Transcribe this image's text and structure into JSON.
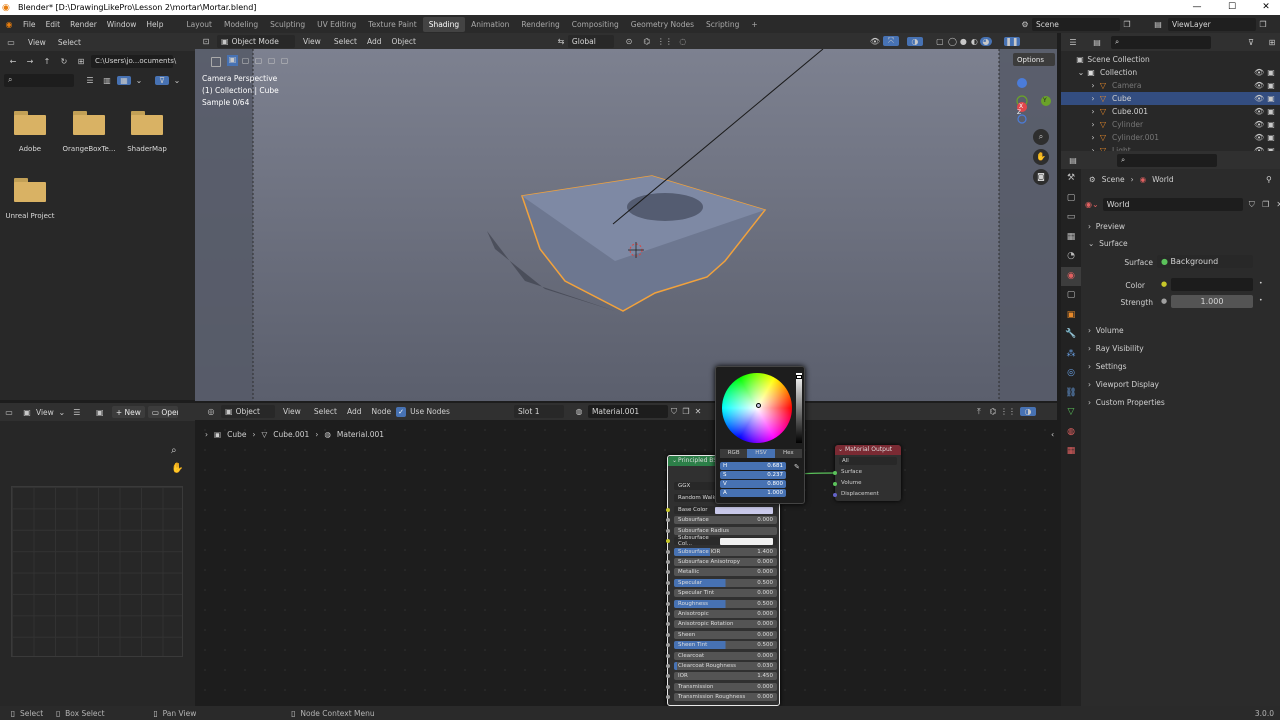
{
  "titlebar": {
    "title": "Blender* [D:\\DrawingLikePro\\Lesson 2\\mortar\\Mortar.blend]",
    "min": "—",
    "max": "☐",
    "close": "✕"
  },
  "menu": {
    "items": [
      "File",
      "Edit",
      "Render",
      "Window",
      "Help"
    ],
    "workspaces": [
      "Layout",
      "Modeling",
      "Sculpting",
      "UV Editing",
      "Texture Paint",
      "Shading",
      "Animation",
      "Rendering",
      "Compositing",
      "Geometry Nodes",
      "Scripting"
    ],
    "active_workspace": "Shading",
    "add": "+",
    "scene": "Scene",
    "view_layer": "ViewLayer"
  },
  "filebrowser": {
    "view": "View",
    "select": "Select",
    "path": "C:\\Users\\jo...ocuments\\",
    "folders": [
      "Adobe",
      "OrangeBoxTe...",
      "ShaderMap",
      "Unreal Project"
    ]
  },
  "viewport": {
    "mode": "Object Mode",
    "menus": [
      "View",
      "Select",
      "Add",
      "Object"
    ],
    "orientation": "Global",
    "options": "Options",
    "overlay_lines": [
      "Camera Perspective",
      "(1) Collection | Cube",
      "Sample 0/64"
    ],
    "gizmo": {
      "x": "X",
      "y": "Y",
      "z": "Z"
    }
  },
  "node_editor": {
    "editor_type": "Object",
    "menus": [
      "View",
      "Select",
      "Add",
      "Node"
    ],
    "use_nodes": "Use Nodes",
    "slot": "Slot 1",
    "material": "Material.001",
    "breadcrumb": [
      "Cube",
      "Cube.001",
      "Material.001"
    ],
    "image_editor": {
      "view": "View",
      "new": "New",
      "open": "Open"
    },
    "principled": {
      "title": "Principled BSDF",
      "dist": "GGX",
      "sss": "Random Walk",
      "rows": [
        {
          "label": "Base Color",
          "value": "",
          "fill": 0,
          "color": "#c9c9ea"
        },
        {
          "label": "Subsurface",
          "value": "0.000",
          "fill": 0
        },
        {
          "label": "Subsurface Radius",
          "value": "",
          "fill": 0,
          "dropdown": true
        },
        {
          "label": "Subsurface Col...",
          "value": "",
          "fill": 0,
          "color": "#f0f0f0"
        },
        {
          "label": "Subsurface IOR",
          "value": "1.400",
          "fill": 0.35
        },
        {
          "label": "Subsurface Anisotropy",
          "value": "0.000",
          "fill": 0
        },
        {
          "label": "Metallic",
          "value": "0.000",
          "fill": 0
        },
        {
          "label": "Specular",
          "value": "0.500",
          "fill": 0.5
        },
        {
          "label": "Specular Tint",
          "value": "0.000",
          "fill": 0
        },
        {
          "label": "Roughness",
          "value": "0.500",
          "fill": 0.5
        },
        {
          "label": "Anisotropic",
          "value": "0.000",
          "fill": 0
        },
        {
          "label": "Anisotropic Rotation",
          "value": "0.000",
          "fill": 0
        },
        {
          "label": "Sheen",
          "value": "0.000",
          "fill": 0
        },
        {
          "label": "Sheen Tint",
          "value": "0.500",
          "fill": 0.5
        },
        {
          "label": "Clearcoat",
          "value": "0.000",
          "fill": 0
        },
        {
          "label": "Clearcoat Roughness",
          "value": "0.030",
          "fill": 0.03
        },
        {
          "label": "IOR",
          "value": "1.450",
          "fill": 0
        },
        {
          "label": "Transmission",
          "value": "0.000",
          "fill": 0
        },
        {
          "label": "Transmission Roughness",
          "value": "0.000",
          "fill": 0
        }
      ]
    },
    "output": {
      "title": "Material Output",
      "target": "All",
      "sockets": [
        "Surface",
        "Volume",
        "Displacement"
      ]
    },
    "picker": {
      "tabs": [
        "RGB",
        "HSV",
        "Hex"
      ],
      "active": "HSV",
      "values": [
        {
          "k": "H",
          "v": "0.681"
        },
        {
          "k": "S",
          "v": "0.237"
        },
        {
          "k": "V",
          "v": "0.800"
        },
        {
          "k": "A",
          "v": "1.000"
        }
      ]
    }
  },
  "outliner": {
    "root": "Scene Collection",
    "items": [
      {
        "name": "Collection",
        "depth": 0,
        "icon": "collection-icon"
      },
      {
        "name": "Camera",
        "depth": 1,
        "dim": true
      },
      {
        "name": "Cube",
        "depth": 1,
        "selected": true
      },
      {
        "name": "Cube.001",
        "depth": 1
      },
      {
        "name": "Cylinder",
        "depth": 1,
        "dim": true
      },
      {
        "name": "Cylinder.001",
        "depth": 1,
        "dim": true
      },
      {
        "name": "Light",
        "depth": 1,
        "dim": true
      }
    ]
  },
  "properties": {
    "breadcrumb": [
      "Scene",
      "World"
    ],
    "world": "World",
    "panels": [
      "Preview",
      "Surface",
      "Volume",
      "Ray Visibility",
      "Settings",
      "Viewport Display",
      "Custom Properties"
    ],
    "surface_label": "Surface",
    "surface_value": "Background",
    "color_label": "Color",
    "strength_label": "Strength",
    "strength_value": "1.000"
  },
  "status": {
    "select": "Select",
    "box_select": "Box Select",
    "pan_view": "Pan View",
    "context_menu": "Node Context Menu",
    "version": "3.0.0"
  },
  "colors": {
    "accent": "#4772b3",
    "selection": "#f2a23c",
    "header": "#303030"
  }
}
